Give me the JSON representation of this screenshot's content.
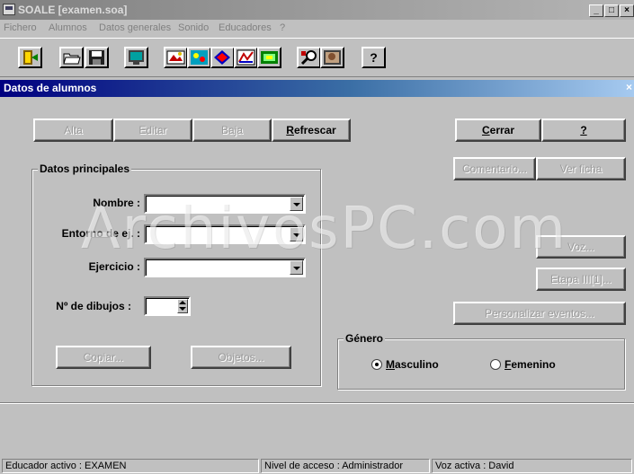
{
  "window": {
    "title": "SOALE [examen.soa]",
    "minimize": "_",
    "maximize": "□",
    "close": "×"
  },
  "menu": [
    "Fichero",
    "Alumnos",
    "Datos generales",
    "Sonido",
    "Educadores",
    "?"
  ],
  "toolbar": {
    "icons": [
      "exit-icon",
      "open-icon",
      "save-icon",
      "monitor-icon",
      "drawing-icon",
      "palette-icon",
      "shapes-icon",
      "chart-icon",
      "folder-image-icon",
      "search-icon",
      "image-icon",
      "help-icon"
    ],
    "help_glyph": "?"
  },
  "child": {
    "title": "Datos de alumnos",
    "close": "×",
    "buttons": {
      "alta": "Alta",
      "editar": "Editar",
      "baja": "Baja",
      "refrescar_ul": "R",
      "refrescar_rest": "efrescar",
      "cerrar_ul": "C",
      "cerrar_rest": "errar",
      "help": "?",
      "comentario": "Comentario...",
      "ver_ficha": "Ver ficha",
      "voz": "Voz...",
      "etapa": "Etapa III[1]...",
      "personalizar": "Personalizar eventos...",
      "copiar": "Copiar...",
      "objetos": "Objetos..."
    },
    "datos_principales": {
      "legend": "Datos principales",
      "nombre_label": "Nombre :",
      "entorno_label": "Entorno de ej. :",
      "ejercicio_label": "Ejercicio :",
      "dibujos_label": "Nº de dibujos :"
    },
    "genero": {
      "legend": "Género",
      "masculino_ul": "M",
      "masculino_rest": "asculino",
      "femenino_ul": "F",
      "femenino_rest": "emenino",
      "selected": "Masculino"
    }
  },
  "watermark": "ArchivosPC.com",
  "status": {
    "educador": "Educador activo :  EXAMEN",
    "nivel": "Nivel de acceso :  Administrador",
    "voz": "Voz activa :  David"
  }
}
